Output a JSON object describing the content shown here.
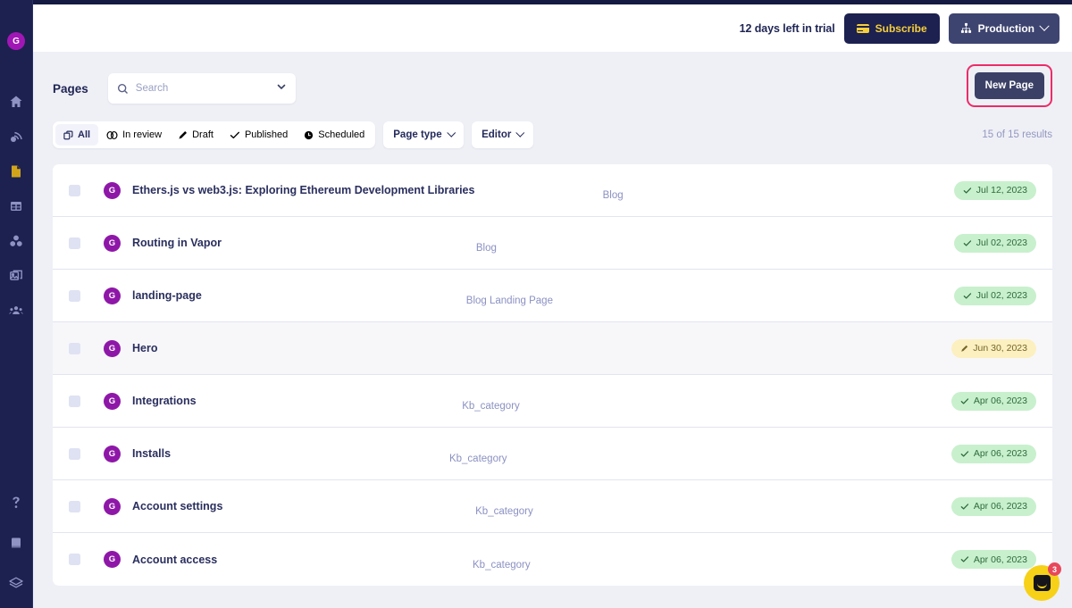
{
  "sidebar": {
    "avatar_initial": "G",
    "items": [
      {
        "name": "home-icon",
        "label": "Home"
      },
      {
        "name": "blog-icon",
        "label": "Blog"
      },
      {
        "name": "pages-icon",
        "label": "Pages",
        "active": true
      },
      {
        "name": "collections-icon",
        "label": "Collections"
      },
      {
        "name": "components-icon",
        "label": "Components"
      },
      {
        "name": "media-icon",
        "label": "Media"
      },
      {
        "name": "team-icon",
        "label": "Team"
      }
    ],
    "bottom_items": [
      {
        "name": "help-icon",
        "label": "Help"
      },
      {
        "name": "docs-icon",
        "label": "Docs"
      },
      {
        "name": "layers-icon",
        "label": "Layers"
      }
    ]
  },
  "header": {
    "trial_text": "12 days left in trial",
    "subscribe_label": "Subscribe",
    "environment_label": "Production"
  },
  "pages": {
    "title": "Pages",
    "search_placeholder": "Search",
    "search_value": "",
    "new_page_label": "New Page",
    "results_text": "15 of 15 results"
  },
  "filters": {
    "tabs": [
      {
        "label": "All",
        "icon": "copy-icon",
        "active": true
      },
      {
        "label": "In review",
        "icon": "eye-icon",
        "active": false
      },
      {
        "label": "Draft",
        "icon": "pencil-icon",
        "active": false
      },
      {
        "label": "Published",
        "icon": "check-icon",
        "active": false
      },
      {
        "label": "Scheduled",
        "icon": "clock-icon",
        "active": false
      }
    ],
    "page_type_label": "Page type",
    "editor_label": "Editor"
  },
  "rows": [
    {
      "avatar": "G",
      "title": "Ethers.js vs web3.js: Exploring Ethereum Development Libraries",
      "type": "Blog",
      "status": "published",
      "date": "Jul 12, 2023",
      "highlight": false
    },
    {
      "avatar": "G",
      "title": "Routing in Vapor",
      "type": "Blog",
      "status": "published",
      "date": "Jul 02, 2023",
      "highlight": false
    },
    {
      "avatar": "G",
      "title": "landing-page",
      "type": "Blog Landing Page",
      "status": "published",
      "date": "Jul 02, 2023",
      "highlight": false
    },
    {
      "avatar": "G",
      "title": "Hero",
      "type": "",
      "status": "draft",
      "date": "Jun 30, 2023",
      "highlight": true
    },
    {
      "avatar": "G",
      "title": "Integrations",
      "type": "Kb_category",
      "status": "published",
      "date": "Apr 06, 2023",
      "highlight": false
    },
    {
      "avatar": "G",
      "title": "Installs",
      "type": "Kb_category",
      "status": "published",
      "date": "Apr 06, 2023",
      "highlight": false
    },
    {
      "avatar": "G",
      "title": "Account settings",
      "type": "Kb_category",
      "status": "published",
      "date": "Apr 06, 2023",
      "highlight": false
    },
    {
      "avatar": "G",
      "title": "Account access",
      "type": "Kb_category",
      "status": "published",
      "date": "Apr 06, 2023",
      "highlight": false
    }
  ],
  "intercom": {
    "unread_count": "3"
  },
  "colors": {
    "sidebar_bg": "#1c2150",
    "accent_yellow": "#f7cf3b",
    "avatar_purple": "#8e17a8",
    "highlight_ring": "#ec2c68",
    "published_bg": "#c8f0cd",
    "draft_bg": "#fcf0c0"
  }
}
